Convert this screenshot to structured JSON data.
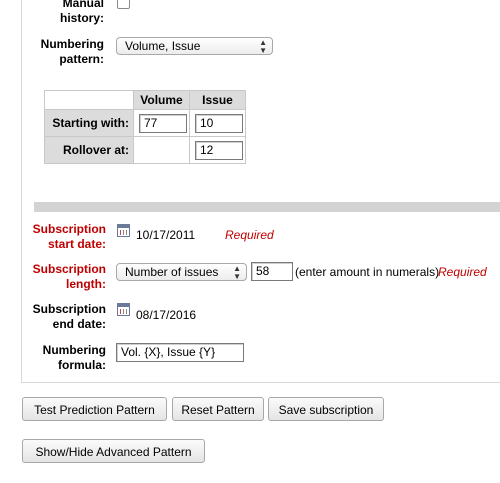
{
  "form": {
    "manual_history": {
      "label_line1": "Manual",
      "label_line2": "history:",
      "checked": false
    },
    "numbering_pattern": {
      "label_line1": "Numbering",
      "label_line2": "pattern:",
      "selected": "Volume, Issue"
    },
    "grid": {
      "columns": [
        "Volume",
        "Issue"
      ],
      "rows": [
        {
          "label": "Starting with:",
          "volume": "77",
          "issue": "10"
        },
        {
          "label": "Rollover at:",
          "volume": "",
          "issue": "12"
        }
      ]
    },
    "subscription_start": {
      "label_line1": "Subscription",
      "label_line2": "start date:",
      "value": "10/17/2011",
      "required_note": "Required"
    },
    "subscription_length": {
      "label_line1": "Subscription",
      "label_line2": "length:",
      "selected": "Number of issues",
      "value": "58",
      "hint": "(enter amount in numerals)",
      "required_note": "Required"
    },
    "subscription_end": {
      "label_line1": "Subscription",
      "label_line2": "end date:",
      "value": "08/17/2016"
    },
    "numbering_formula": {
      "label_line1": "Numbering",
      "label_line2": "formula:",
      "value": "Vol. {X}, Issue {Y}"
    }
  },
  "buttons": {
    "test_prediction": "Test Prediction Pattern",
    "reset_pattern": "Reset Pattern",
    "save_subscription": "Save subscription",
    "show_hide_advanced": "Show/Hide Advanced Pattern"
  },
  "colors": {
    "required": "#c00000",
    "section_bar": "#d3d3d3",
    "grid_header": "#dcdcdc"
  }
}
